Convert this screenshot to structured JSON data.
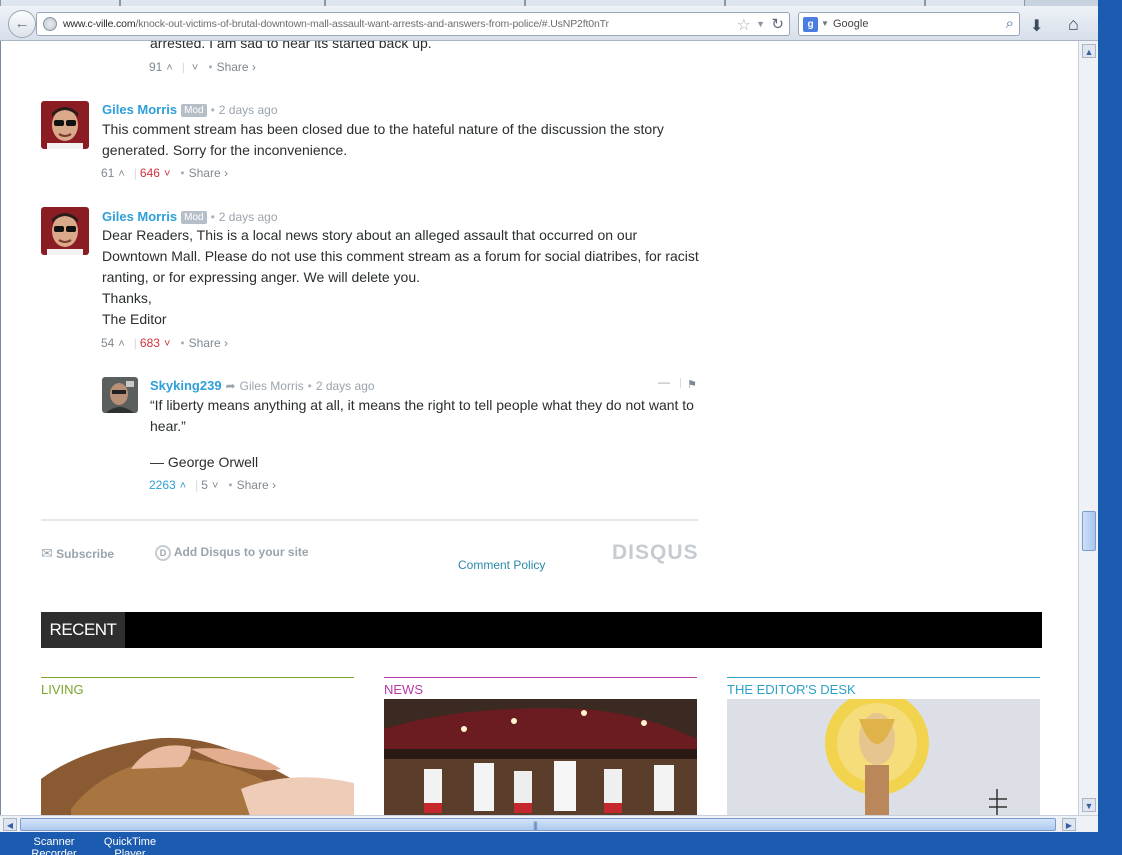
{
  "browser": {
    "url_domain": "www.c-ville.com",
    "url_path": "/knock-out-victims-of-brutal-downtown-mall-assault-want-arrests-and-answers-from-police/#.UsNP2ft0nTr",
    "search_engine_badge": "g",
    "search_placeholder": "Google"
  },
  "icons": {
    "back": "back-arrow-icon",
    "globe": "globe-icon",
    "star": "bookmark-star-icon",
    "reload": "reload-icon",
    "search": "magnifier-icon",
    "download": "download-arrow-icon",
    "home": "home-icon"
  },
  "comments": {
    "prev": {
      "body_tail": "arrested. I am sad to hear its started back up.",
      "up": "91",
      "share": "Share ›"
    },
    "c1": {
      "author": "Giles Morris",
      "badge": "Mod",
      "time": "2 days ago",
      "body": "This comment stream has been closed due to the hateful nature of the discussion the story generated. Sorry for the inconvenience.",
      "up": "61",
      "down": "646",
      "share": "Share ›"
    },
    "c2": {
      "author": "Giles Morris",
      "badge": "Mod",
      "time": "2 days ago",
      "body_p1": "Dear Readers, This is a local news story about an alleged assault that occurred on our Downtown Mall. Please do not use this comment stream as a forum for social diatribes, for racist ranting, or for expressing anger. We will delete you.",
      "body_p2": "Thanks,",
      "body_p3": "The Editor",
      "up": "54",
      "down": "683",
      "share": "Share ›"
    },
    "reply": {
      "author": "Skyking239",
      "reply_to": "Giles Morris",
      "time": "2 days ago",
      "quote": "“If liberty means anything at all, it means the right to tell people what they do not want to hear.”",
      "attribution": "— George Orwell",
      "up": "2263",
      "down": "5",
      "share": "Share ›"
    }
  },
  "footer": {
    "subscribe": "Subscribe",
    "add_disqus": "Add Disqus to your site",
    "logo": "DISQUS",
    "comment_policy": "Comment Policy"
  },
  "recent": {
    "label": "RECENT",
    "categories": [
      {
        "name": "LIVING",
        "color": "#7aa62b"
      },
      {
        "name": "NEWS",
        "color": "#b43aa6"
      },
      {
        "name": "THE EDITOR'S DESK",
        "color": "#2ea0c4"
      }
    ]
  },
  "desktop": {
    "icon1": "Scanner Recorder",
    "icon2": "QuickTime Player"
  }
}
